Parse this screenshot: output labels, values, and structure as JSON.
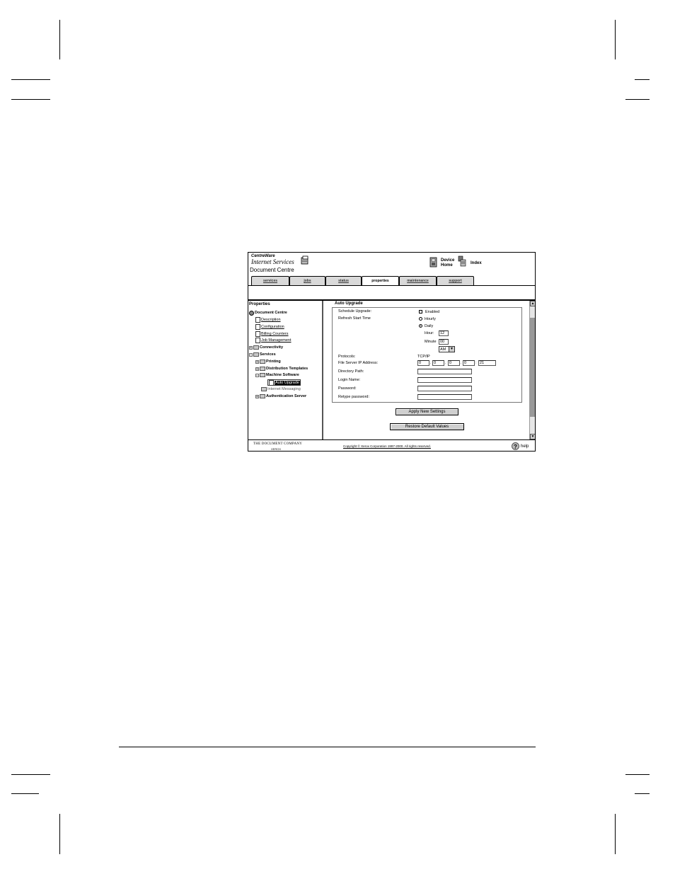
{
  "brand": {
    "top": "CentreWare",
    "main": "Internet Services"
  },
  "device_title": "Document Centre",
  "header_links": {
    "device_home": [
      "Device",
      "Home"
    ],
    "index": "Index"
  },
  "tabs": [
    {
      "label": "services",
      "active": false
    },
    {
      "label": "jobs",
      "active": false
    },
    {
      "label": "status",
      "active": false
    },
    {
      "label": "properties",
      "active": true
    },
    {
      "label": "maintenance",
      "active": false
    },
    {
      "label": "support",
      "active": false
    }
  ],
  "tree": {
    "heading": "Properties",
    "items": [
      {
        "label": "Document Centre"
      },
      {
        "label": "Description"
      },
      {
        "label": "Configuration"
      },
      {
        "label": "Billing Counters"
      },
      {
        "label": "Job Management"
      },
      {
        "label": "Connectivity"
      },
      {
        "label": "Services"
      },
      {
        "label": "Printing"
      },
      {
        "label": "Distribution Templates"
      },
      {
        "label": "Machine Software"
      },
      {
        "label": "Auto Upgrade"
      },
      {
        "label": "Internet Messaging"
      },
      {
        "label": "Authentication Server"
      }
    ]
  },
  "form": {
    "heading": "Auto Upgrade",
    "schedule_label": "Schedule Upgrade:",
    "enabled_label": "Enabled",
    "refresh_label": "Refresh Start Time",
    "hourly_label": "Hourly",
    "daily_label": "Daily",
    "hour_label": "Hour:",
    "hour_value": "12",
    "minute_label": "Minute",
    "minute_value": "00",
    "ampm_value": "AM",
    "protocols_label": "Protocols:",
    "protocols_value": "TCP/IP",
    "ip_label": "File Server IP Address:",
    "ip_values": [
      "0",
      "0",
      "0",
      "0",
      "21"
    ],
    "dir_label": "Directory Path:",
    "login_label": "Login Name:",
    "password_label": "Password:",
    "retype_label": "Retype password:",
    "apply_label": "Apply New Settings",
    "restore_label": "Restore Default Values"
  },
  "footer": {
    "company": "THE DOCUMENT COMPANY",
    "xerox": "XEROX",
    "copyright": "Copyright © Xerox Corporation 1997-2000.  All rights reserved.",
    "help": "help"
  }
}
